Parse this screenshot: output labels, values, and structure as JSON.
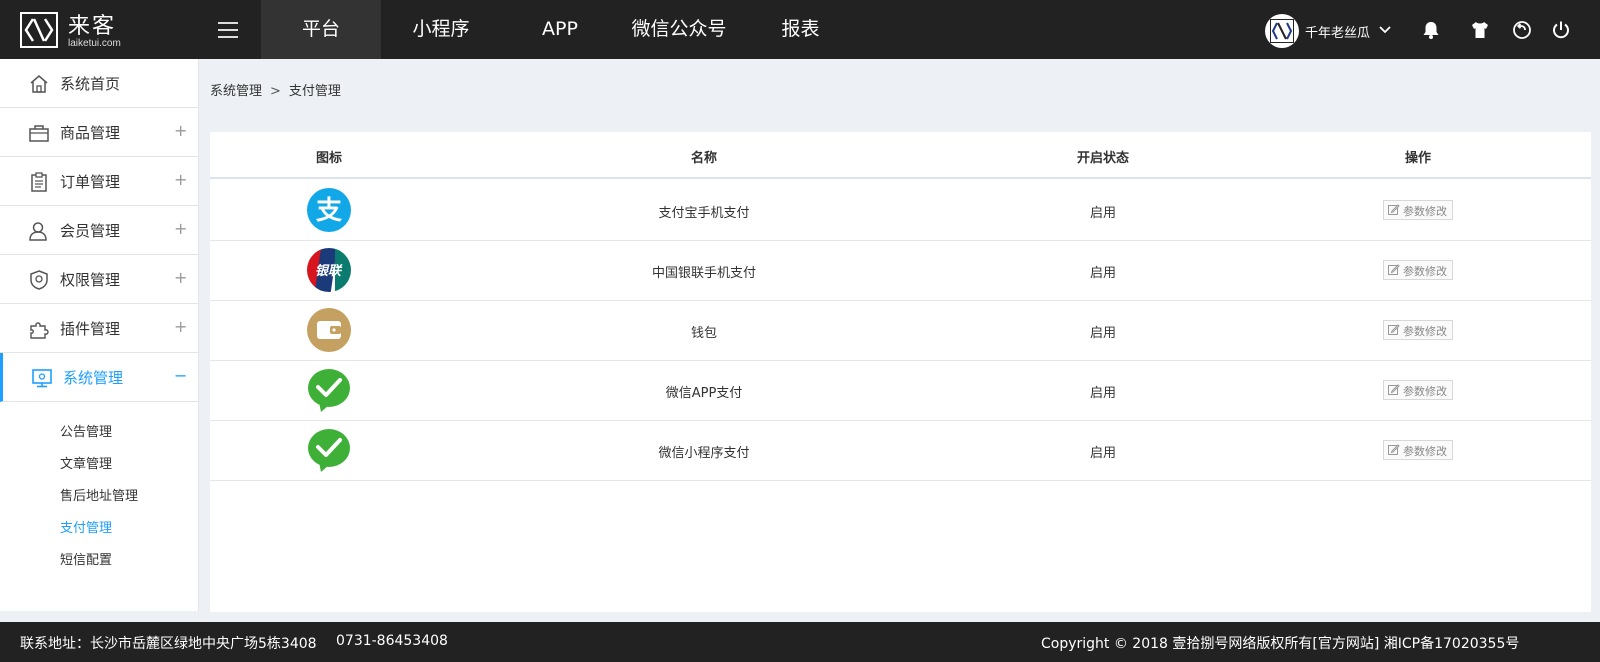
{
  "header": {
    "logo_name": "来客",
    "logo_url": "laiketui.com",
    "tabs": [
      {
        "label": "平台",
        "active": true
      },
      {
        "label": "小程序",
        "active": false
      },
      {
        "label": "APP",
        "active": false
      },
      {
        "label": "微信公众号",
        "active": false
      },
      {
        "label": "报表",
        "active": false
      }
    ],
    "user_name": "千年老丝瓜",
    "icons": [
      "bell-icon",
      "shirt-icon",
      "refresh-icon",
      "power-icon"
    ]
  },
  "sidebar": {
    "items": [
      {
        "label": "系统首页",
        "icon": "home-icon",
        "expander": ""
      },
      {
        "label": "商品管理",
        "icon": "bag-icon",
        "expander": "+"
      },
      {
        "label": "订单管理",
        "icon": "clipboard-icon",
        "expander": "+"
      },
      {
        "label": "会员管理",
        "icon": "user-icon",
        "expander": "+"
      },
      {
        "label": "权限管理",
        "icon": "shield-icon",
        "expander": "+"
      },
      {
        "label": "插件管理",
        "icon": "puzzle-icon",
        "expander": "+"
      },
      {
        "label": "系统管理",
        "icon": "monitor-icon",
        "expander": "−"
      }
    ],
    "sub_items": [
      {
        "label": "公告管理",
        "active": false
      },
      {
        "label": "文章管理",
        "active": false
      },
      {
        "label": "售后地址管理",
        "active": false
      },
      {
        "label": "支付管理",
        "active": true
      },
      {
        "label": "短信配置",
        "active": false
      }
    ]
  },
  "breadcrumb": {
    "parent": "系统管理",
    "separator": ">",
    "current": "支付管理"
  },
  "table": {
    "headers": [
      "图标",
      "名称",
      "开启状态",
      "操作"
    ],
    "rows": [
      {
        "icon": "alipay-icon",
        "name": "支付宝手机支付",
        "status": "启用",
        "action": "参数修改"
      },
      {
        "icon": "unionpay-icon",
        "name": "中国银联手机支付",
        "status": "启用",
        "action": "参数修改"
      },
      {
        "icon": "wallet-icon",
        "name": "钱包",
        "status": "启用",
        "action": "参数修改"
      },
      {
        "icon": "wechat-pay-icon",
        "name": "微信APP支付",
        "status": "启用",
        "action": "参数修改"
      },
      {
        "icon": "wechat-pay-icon",
        "name": "微信小程序支付",
        "status": "启用",
        "action": "参数修改"
      }
    ],
    "icon_text": {
      "alipay": "支",
      "unionpay": "银联"
    }
  },
  "footer": {
    "address": "联系地址：长沙市岳麓区绿地中央广场5栋3408",
    "phone": "0731-86453408",
    "copyright": "Copyright © 2018 壹拾捌号网络版权所有[官方网站]    湘ICP备17020355号"
  },
  "colors": {
    "topbar": "#222222",
    "accent": "#1e9fff",
    "alipay": "#12a8e8",
    "wechat": "#3fb037",
    "wallet": "#c4a061"
  }
}
